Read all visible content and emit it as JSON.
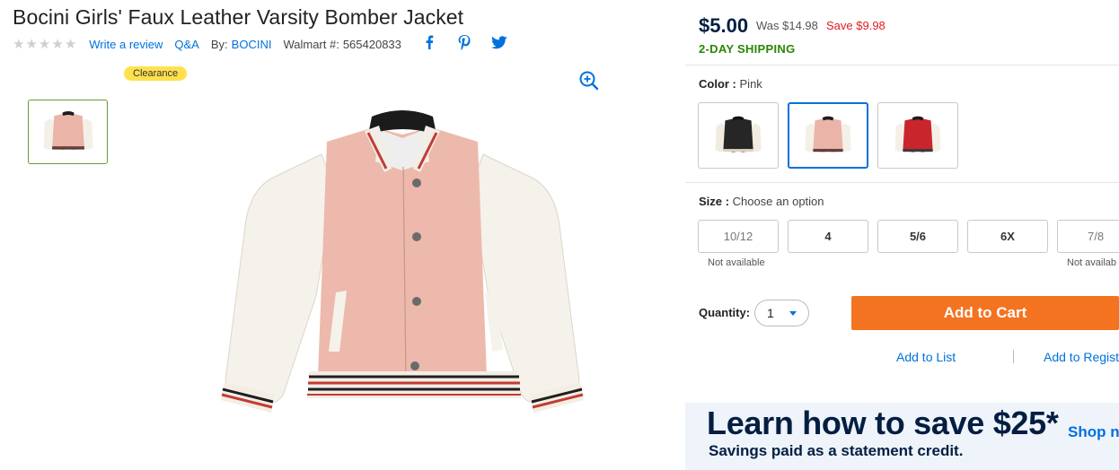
{
  "product": {
    "title": "Bocini Girls' Faux Leather Varsity Bomber Jacket",
    "rating_stars": 0,
    "write_review": "Write a review",
    "qa": "Q&A",
    "by_label": "By:",
    "brand": "BOCINI",
    "walmart_label": "Walmart #:",
    "walmart_number": "565420833",
    "social": [
      "facebook-icon",
      "pinterest-icon",
      "twitter-icon"
    ],
    "badge": "Clearance"
  },
  "pricing": {
    "price": "$5.00",
    "was": "Was $14.98",
    "save": "Save $9.98",
    "shipping": "2-DAY SHIPPING"
  },
  "color": {
    "label": "Color :",
    "value": "Pink",
    "options": [
      "black",
      "pink",
      "red"
    ],
    "selected": "pink"
  },
  "size": {
    "label": "Size :",
    "value": "Choose an option",
    "options": [
      {
        "label": "10/12",
        "note": "Not available"
      },
      {
        "label": "4",
        "note": ""
      },
      {
        "label": "5/6",
        "note": ""
      },
      {
        "label": "6X",
        "note": ""
      },
      {
        "label": "7/8",
        "note": "Not availab"
      }
    ]
  },
  "purchase": {
    "quantity_label": "Quantity:",
    "quantity_value": "1",
    "add_to_cart": "Add to Cart",
    "add_to_list": "Add to List",
    "add_to_registry": "Add to Regist"
  },
  "banner": {
    "headline": "Learn how to save $25*",
    "subline": "Savings paid as a statement credit.",
    "shop_now": "Shop n"
  },
  "colors": {
    "link": "#0071dc",
    "cart": "#f47321",
    "ship": "#2a8703",
    "save": "#de1c24",
    "navy": "#041e42"
  }
}
